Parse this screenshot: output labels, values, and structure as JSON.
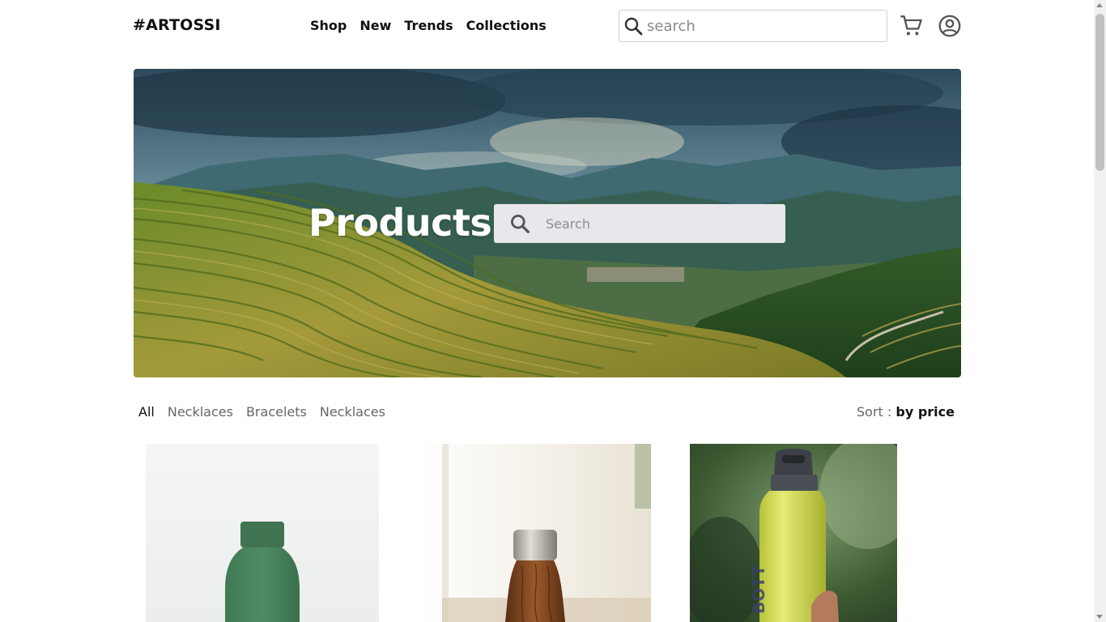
{
  "header": {
    "logo": "#ARTOSSI",
    "nav": [
      "Shop",
      "New",
      "Trends",
      "Collections"
    ],
    "search_placeholder": "search",
    "icons": {
      "search": "search-icon",
      "cart": "cart-icon",
      "account": "account-circle-icon"
    }
  },
  "hero": {
    "title": "Products",
    "search_placeholder": "Search",
    "image": "rice-terraces-mountain-landscape"
  },
  "filters": {
    "categories": [
      "All",
      "Necklaces",
      "Bracelets",
      "Necklaces"
    ],
    "active": "All"
  },
  "sort": {
    "label": "Sort :",
    "value": "by price"
  },
  "products": [
    {
      "image": "green-matte-bottle"
    },
    {
      "image": "wood-grain-bottle"
    },
    {
      "image": "yellow-bottle-in-hand"
    }
  ],
  "colors": {
    "text": "#111111",
    "muted": "#666666",
    "hero_search_bg": "#e7e7ec"
  }
}
